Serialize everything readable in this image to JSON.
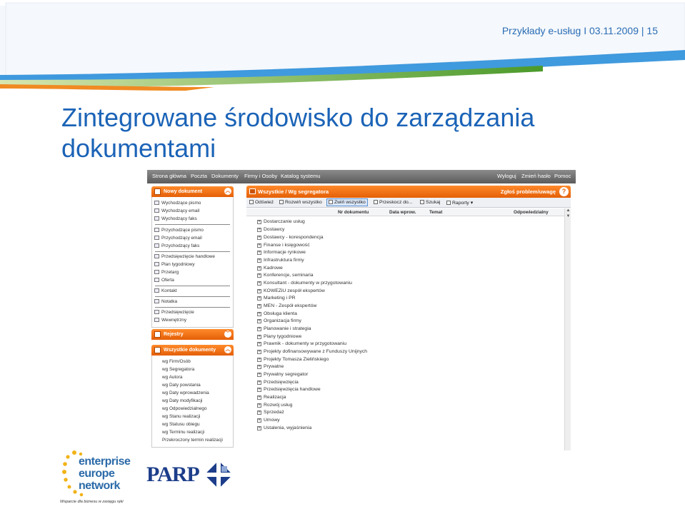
{
  "slide": {
    "header_text": "Przykłady e-usług I 03.11.2009 | 15",
    "title": "Zintegrowane środowisko do zarządzania dokumentami"
  },
  "app": {
    "topnav": [
      "Strona główna",
      "Poczta",
      "Dokumenty",
      "Firmy i Osoby",
      "Katalog systemu"
    ],
    "topnav_right": [
      "Wyloguj",
      "Zmień hasło",
      "Pomoc"
    ],
    "sidebar": {
      "new_doc_header": "Nowy dokument",
      "groups": [
        [
          "Wychodzące pismo",
          "Wychodzący email",
          "Wychodzący faks"
        ],
        [
          "Przychodzące pismo",
          "Przychodzący email",
          "Przychodzący faks"
        ],
        [
          "Przedsięwzięcie handlowe",
          "Plan tygodniowy",
          "Przetarg",
          "Oferta"
        ],
        [
          "Kontakt"
        ],
        [
          "Notatka"
        ],
        [
          "Przedsięwzięcie",
          "Wewnętrzny"
        ]
      ],
      "registers_header": "Rejestry",
      "all_docs_header": "Wszystkie dokumenty",
      "all_docs_links": [
        "wg Firm/Osób",
        "wg Segregatora",
        "wg Autora",
        "wg Daty powstania",
        "wg Daty wprowadzenia",
        "wg Daty modyfikacji",
        "wg Odpowiedzialnego",
        "wg Stanu realizacji",
        "wg Statusu obiegu",
        "wg Terminu realizacji",
        "Przekroczony termin realizacji"
      ]
    },
    "main": {
      "header": "Wszystkie / Wg segregatora",
      "report_link": "Zgłoś problem/uwagę",
      "help": "?",
      "toolbar": [
        "Odśwież",
        "Rozwiń wszystko",
        "Zwiń wszystko",
        "Przeskocz do...",
        "Szukaj",
        "Raporty"
      ],
      "columns": [
        "Nr dokumentu",
        "Data wprow.",
        "Temat",
        "Odpowiedzialny"
      ],
      "tree": [
        "Dostarczanie usług",
        "Dostawcy",
        "Dostawcy - korespondencja",
        "Finanse i księgowość",
        "Informacje rynkowe",
        "Infrastruktura firmy",
        "Kadrowe",
        "Konferencje, seminaria",
        "Konsultant - dokumenty w przygotowaniu",
        "KOWEZiU zespół ekspertów",
        "Marketing i PR",
        "MEN - Zespół ekspertów",
        "Obsługa klienta",
        "Organizacja firmy",
        "Planowanie i strategia",
        "Plany tygodniowe",
        "Prawnik - dokumenty w przygotowaniu",
        "Projekty dofinansowywane z Funduszy Unijnych",
        "Projekty Tomasza Zielińskiego",
        "Prywatne",
        "Prywatny segregator",
        "Przedsięwzięcia",
        "Przedsięwzięcia handlowe",
        "Realizacja",
        "Rozwój usług",
        "Sprzedaż",
        "Umowy",
        "Ustalenia, wyjaśnienia"
      ]
    }
  },
  "logos": {
    "een_lines": [
      "enterprise",
      "europe",
      "network"
    ],
    "een_tagline": "Wsparcie dla biznesu w zasięgu ręki",
    "parp": "PARP"
  },
  "colors": {
    "title_blue": "#1b63b7",
    "accent_orange": "#e45f07",
    "band_blue": "#1e88d8",
    "band_green": "#6aa82f"
  },
  "icons": [
    "document-icon",
    "email-icon",
    "fax-icon",
    "chevron-up-icon",
    "chevron-down-icon",
    "help-icon",
    "refresh-icon",
    "expand-icon",
    "collapse-icon",
    "jump-icon",
    "search-icon",
    "reports-icon",
    "plus-box-icon",
    "star-ring-icon",
    "parp-logo-icon"
  ]
}
